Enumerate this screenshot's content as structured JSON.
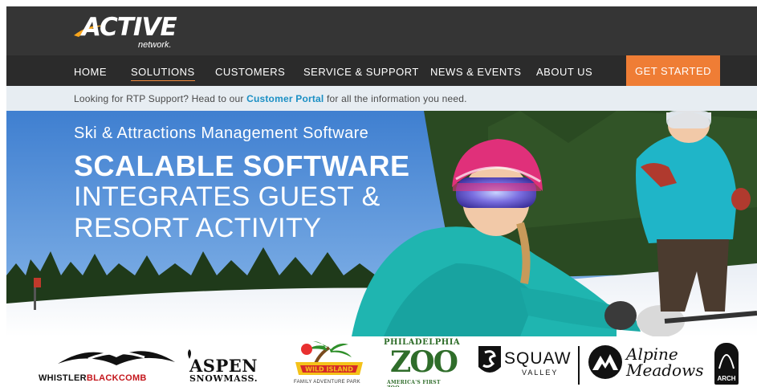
{
  "brand": {
    "logo_text": "ACTIVE",
    "logo_sub": "network."
  },
  "nav": {
    "items": [
      {
        "label": "HOME",
        "active": false
      },
      {
        "label": "SOLUTIONS",
        "active": true
      },
      {
        "label": "CUSTOMERS",
        "active": false
      },
      {
        "label": "SERVICE & SUPPORT",
        "active": false
      },
      {
        "label": "NEWS & EVENTS",
        "active": false
      },
      {
        "label": "ABOUT US",
        "active": false
      }
    ],
    "cta_label": "GET STARTED"
  },
  "notice": {
    "prefix": "Looking for RTP Support? Head to our ",
    "link": "Customer Portal",
    "suffix": " for all the information you need."
  },
  "hero": {
    "eyebrow": "Ski & Attractions Management Software",
    "title": "SCALABLE SOFTWARE",
    "subtitle_line1": "INTEGRATES GUEST &",
    "subtitle_line2": "RESORT ACTIVITY"
  },
  "customers": {
    "whistler": {
      "part1": "WHISTLER",
      "part2": "BLACKCOMB"
    },
    "aspen": {
      "line1": "ASPEN",
      "line2": "SNOWMASS."
    },
    "wild_island": {
      "name": "WILD ISLAND",
      "tagline": "FAMILY ADVENTURE PARK"
    },
    "philadelphia_zoo": {
      "line1": "PHILADELPHIA",
      "line2": "ZOO",
      "tagline": "AMERICA'S FIRST ZOO"
    },
    "squaw": {
      "line1": "SQUAW",
      "line2": "VALLEY"
    },
    "alpine": {
      "line1": "Alpine",
      "line2": "Meadows"
    },
    "arch": {
      "label": "ARCH"
    }
  },
  "colors": {
    "header_bg": "#353535",
    "nav_bg": "#2b2b2b",
    "accent": "#ef7d35",
    "link": "#1a8fc4"
  }
}
